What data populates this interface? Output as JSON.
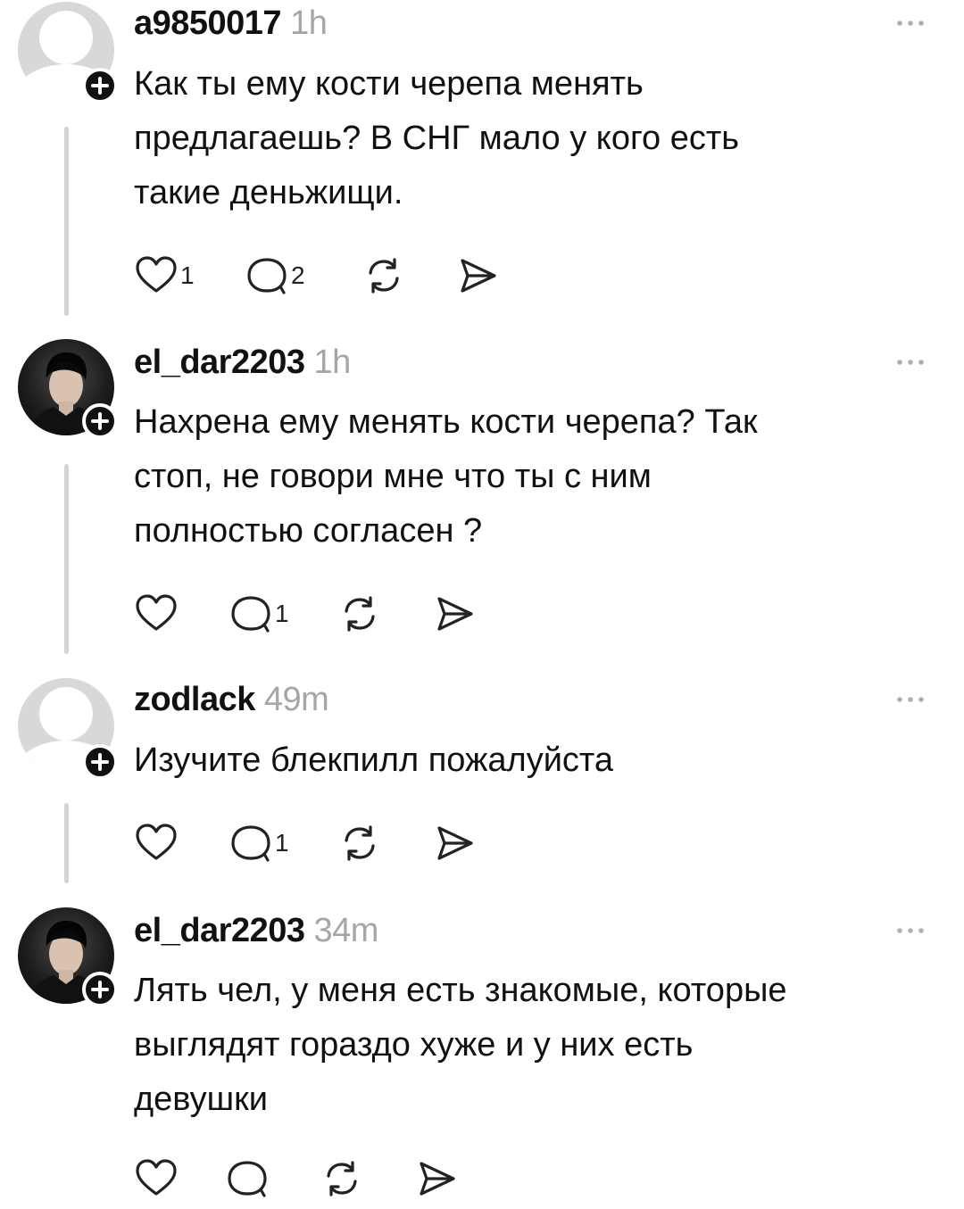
{
  "posts": [
    {
      "username": "a9850017",
      "time": "1h",
      "text_lines": [
        "Как ты ему кости черепа менять",
        "предлагаешь? В СНГ мало у кого есть",
        "такие деньжищи."
      ],
      "likes": "1",
      "replies": "2",
      "avatar": "placeholder-avatar"
    },
    {
      "username": "el_dar2203",
      "time": "1h",
      "text_lines": [
        "Нахрена ему менять кости черепа? Так",
        "стоп, не говори мне что ты с ним",
        "полностью согласен ?"
      ],
      "likes": "",
      "replies": "1",
      "avatar": "photo-avatar"
    },
    {
      "username": "zodlack",
      "time": "49m",
      "text_lines": [
        "Изучите блекпилл пожалуйста"
      ],
      "likes": "",
      "replies": "1",
      "avatar": "placeholder-avatar"
    },
    {
      "username": "el_dar2203",
      "time": "34m",
      "text_lines": [
        "Лять чел, у меня есть знакомые, которые",
        "выглядят гораздо хуже и у них есть",
        "девушки"
      ],
      "likes": "",
      "replies": "",
      "avatar": "photo-avatar"
    }
  ],
  "icons": {
    "like": "heart-icon",
    "reply": "speech-bubble-icon",
    "repost": "repost-icon",
    "share": "send-icon",
    "more": "more-dots-icon",
    "follow": "plus-icon"
  }
}
